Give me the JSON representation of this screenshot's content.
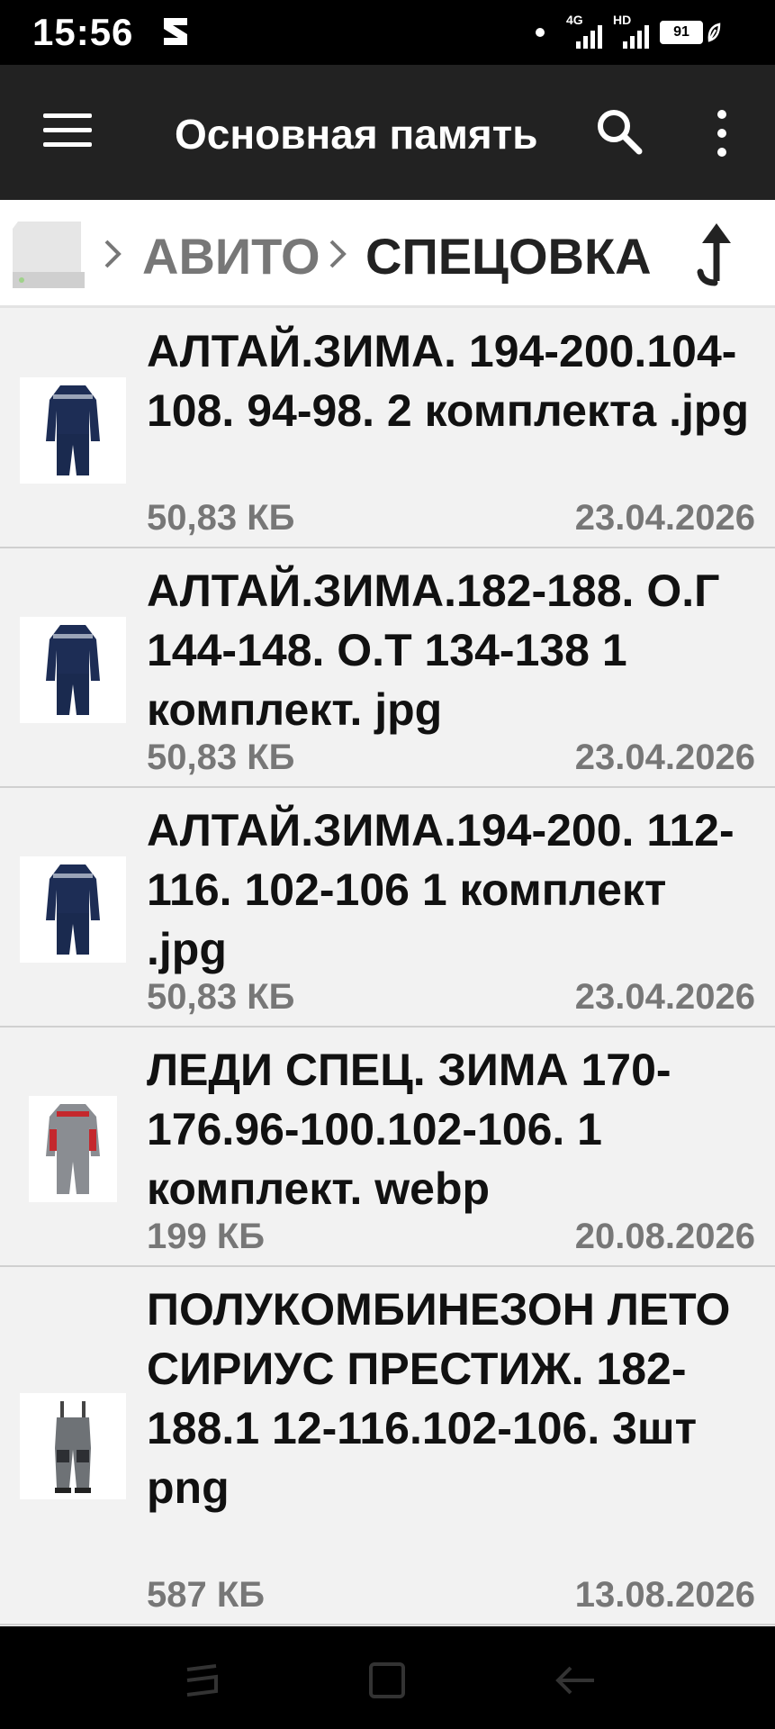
{
  "status_bar": {
    "time": "15:56",
    "network_1": "4G",
    "network_2": "HD",
    "battery": "91"
  },
  "app_bar": {
    "title": "Основная память"
  },
  "breadcrumb": {
    "items": [
      "АВИТО",
      "СПЕЦОВКА"
    ]
  },
  "files": [
    {
      "name": "АЛТАЙ.ЗИМА. 194-200.104-108. 94-98. 2 комплекта .jpg",
      "size": "50,83 КБ",
      "date": "23.04.2026",
      "thumbnail": "navy-winter-suit"
    },
    {
      "name": "АЛТАЙ.ЗИМА.182-188. О.Г 144-148. О.Т 134-138 1 комплект. jpg",
      "size": "50,83 КБ",
      "date": "23.04.2026",
      "thumbnail": "navy-winter-suit"
    },
    {
      "name": "АЛТАЙ.ЗИМА.194-200. 112-116. 102-106 1 комплект .jpg",
      "size": "50,83 КБ",
      "date": "23.04.2026",
      "thumbnail": "navy-winter-suit"
    },
    {
      "name": "ЛЕДИ СПЕЦ. ЗИМА 170-176.96-100.102-106. 1 комплект. webp",
      "size": "199 КБ",
      "date": "20.08.2026",
      "thumbnail": "grey-red-winter-suit"
    },
    {
      "name": "ПОЛУКОМБИНЕЗОН ЛЕТО СИРИУС ПРЕСТИЖ. 182-188.1 12-116.102-106. 3шт png",
      "size": "587 КБ",
      "date": "13.08.2026",
      "thumbnail": "grey-overalls"
    }
  ],
  "colors": {
    "app_bar": "#222222",
    "status_bar": "#000000",
    "list_background": "#f2f2f2",
    "secondary_text": "#777777"
  }
}
